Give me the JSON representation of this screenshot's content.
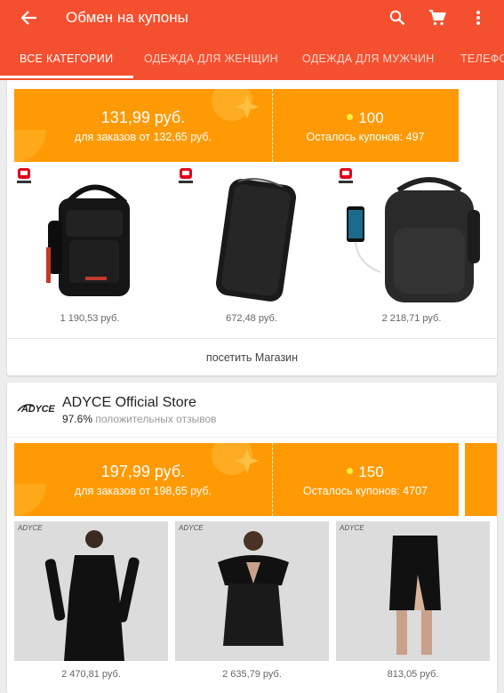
{
  "appbar": {
    "title": "Обмен на купоны",
    "back_icon": "arrow-left-icon",
    "search_icon": "search-icon",
    "cart_icon": "cart-icon",
    "more_icon": "more-vert-icon",
    "bg_color": "#f4502f"
  },
  "tabs": [
    {
      "label": "ВСЕ КАТЕГОРИИ",
      "active": true
    },
    {
      "label": "ОДЕЖДА ДЛЯ ЖЕНЩИН",
      "active": false
    },
    {
      "label": "ОДЕЖДА ДЛЯ МУЖЧИН",
      "active": false
    },
    {
      "label": "ТЕЛЕФО",
      "active": false
    }
  ],
  "store1": {
    "coupon": {
      "amount": "131,99 руб.",
      "condition": "для заказов от 132,65 руб.",
      "coins": "100",
      "remaining": "Осталось купонов: 497"
    },
    "products": [
      {
        "price": "1 190,53 руб.",
        "image": "sling-backpack-black"
      },
      {
        "price": "672,48 руб.",
        "image": "black-wallet"
      },
      {
        "price": "2 218,71 руб.",
        "image": "usb-backpack-black"
      }
    ],
    "visit_label": "посетить Магазин"
  },
  "store2": {
    "logo_text": "ADYCE",
    "name": "ADYCE Official Store",
    "rating_value": "97.6%",
    "rating_label": "положительных отзывов",
    "coupon": {
      "amount": "197,99 руб.",
      "condition": "для заказов от 198,65 руб.",
      "coins": "150",
      "remaining": "Осталось купонов: 4707"
    },
    "products": [
      {
        "price": "2 470,81 руб.",
        "logo": "ADYCE",
        "image": "black-off-shoulder-dress"
      },
      {
        "price": "2 635,79 руб.",
        "logo": "ADYCE",
        "image": "black-feather-mini-dress"
      },
      {
        "price": "813,05 руб.",
        "logo": "ADYCE",
        "image": "black-pencil-skirt"
      }
    ]
  },
  "colors": {
    "accent": "#f4502f",
    "coupon": "#ff9a05",
    "coin": "#ffef3a"
  }
}
